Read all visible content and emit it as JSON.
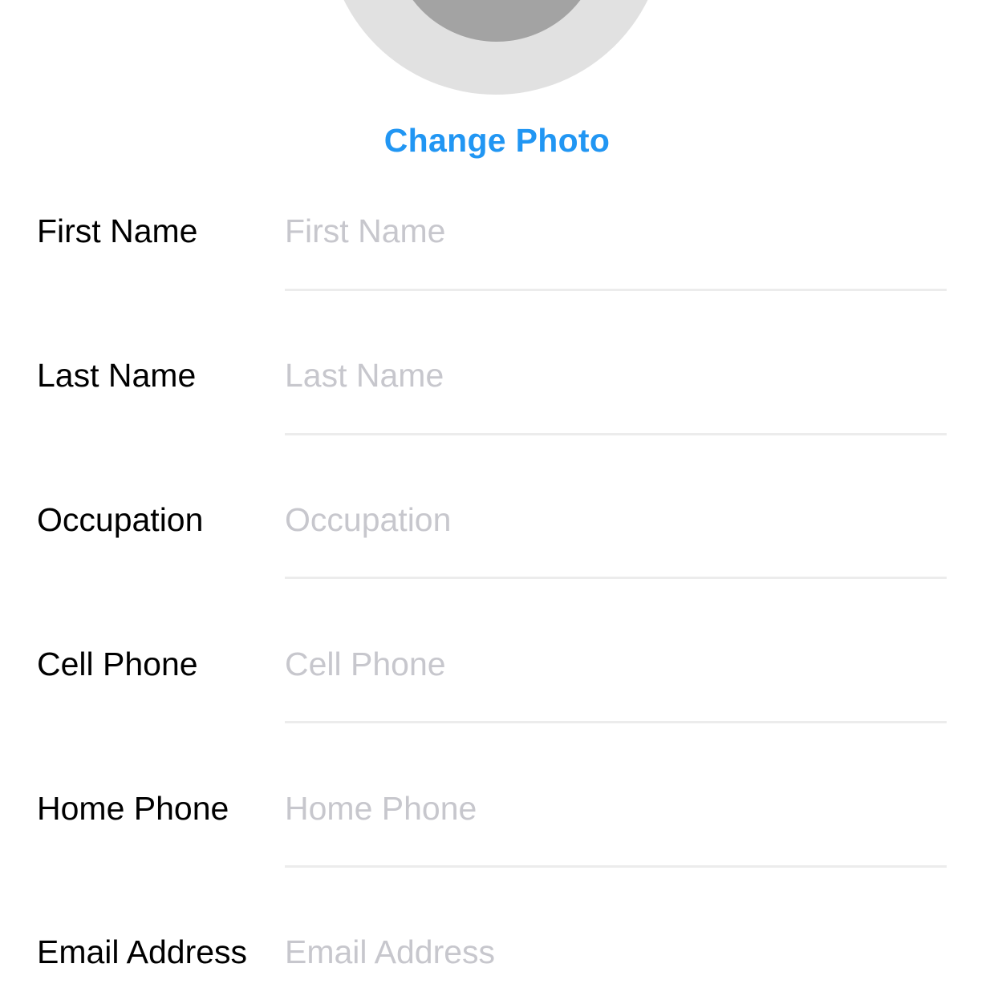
{
  "profile": {
    "change_photo_label": "Change Photo"
  },
  "form": {
    "fields": [
      {
        "label": "First Name",
        "placeholder": "First Name",
        "value": ""
      },
      {
        "label": "Last Name",
        "placeholder": "Last Name",
        "value": ""
      },
      {
        "label": "Occupation",
        "placeholder": "Occupation",
        "value": ""
      },
      {
        "label": "Cell Phone",
        "placeholder": "Cell Phone",
        "value": ""
      },
      {
        "label": "Home Phone",
        "placeholder": "Home Phone",
        "value": ""
      },
      {
        "label": "Email Address",
        "placeholder": "Email Address",
        "value": ""
      }
    ]
  },
  "colors": {
    "accent": "#2196f3",
    "placeholder": "#c7c7cd",
    "avatar_ring": "#e1e1e1",
    "avatar_center": "#a3a3a3",
    "divider": "#ececec"
  }
}
